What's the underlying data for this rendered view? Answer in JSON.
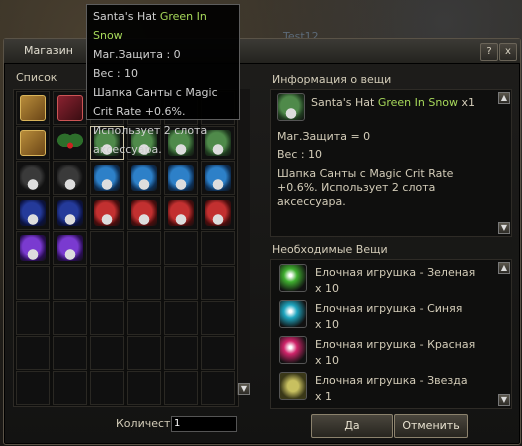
{
  "bg_text": "Test12",
  "window": {
    "title": "Магазин",
    "btn_help": "?",
    "btn_close": "x"
  },
  "left": {
    "list_label": "Список",
    "qty_label": "Количество",
    "qty_value": "1"
  },
  "grid_items": [
    [
      "book-icon",
      "book-red-icon",
      null,
      null,
      null,
      null
    ],
    [
      "book-icon",
      "holly-icon",
      "hat-green-icon",
      "hat-green-icon",
      "hat-green-icon",
      "hat-green-icon"
    ],
    [
      "hat-black-icon",
      "hat-black-icon",
      "hat-blue-icon",
      "hat-blue-icon",
      "hat-blue-icon",
      "hat-blue-icon"
    ],
    [
      "hat-navy-icon",
      "hat-navy-icon",
      "hat-red-icon",
      "hat-red-icon",
      "hat-red-icon",
      "hat-red-icon"
    ],
    [
      "hat-purple-icon",
      "hat-purple-icon",
      null,
      null,
      null,
      null
    ]
  ],
  "hat_colors": {
    "hat-green-icon": [
      "#4f8a4a",
      "#1f3a1f"
    ],
    "hat-black-icon": [
      "#3a3a3a",
      "#111111"
    ],
    "hat-blue-icon": [
      "#2d80c8",
      "#0d2f55"
    ],
    "hat-navy-icon": [
      "#243a9a",
      "#0b1240"
    ],
    "hat-red-icon": [
      "#c23030",
      "#4a0d0d"
    ],
    "hat-purple-icon": [
      "#7a3ad0",
      "#2a0e55"
    ]
  },
  "info": {
    "title": "Информация о вещи",
    "name": "Santa's Hat",
    "grade": "Green In Snow",
    "count": "x1",
    "mdef": "Маг.Защита = 0",
    "weight": "Вес : 10",
    "desc": "Шапка Санты с Magic Crit Rate +0.6%. Использует 2 слота аксессуара."
  },
  "required": {
    "title": "Необходимые Вещи",
    "items": [
      {
        "name": "Елочная игрушка - Зеленая",
        "qty": "x 10",
        "icon": "green-ornament-icon",
        "color": "#3fae2f"
      },
      {
        "name": "Елочная игрушка - Синяя",
        "qty": "x 10",
        "icon": "blue-ornament-icon",
        "color": "#1fa6c0"
      },
      {
        "name": "Елочная игрушка - Красная",
        "qty": "x 10",
        "icon": "red-ornament-icon",
        "color": "#d0246a"
      },
      {
        "name": "Елочная игрушка - Звезда",
        "qty": "x 1",
        "icon": "star-ornament-icon",
        "color": "#c8c060"
      }
    ]
  },
  "buttons": {
    "ok": "Да",
    "cancel": "Отменить"
  },
  "tooltip": {
    "name": "Santa's Hat",
    "grade": "Green In Snow",
    "mdef": "Маг.Защита : 0",
    "weight": "Вес : 10",
    "desc": "Шапка Санты с Magic Crit Rate +0.6%. Использует 2 слота аксессуара."
  }
}
